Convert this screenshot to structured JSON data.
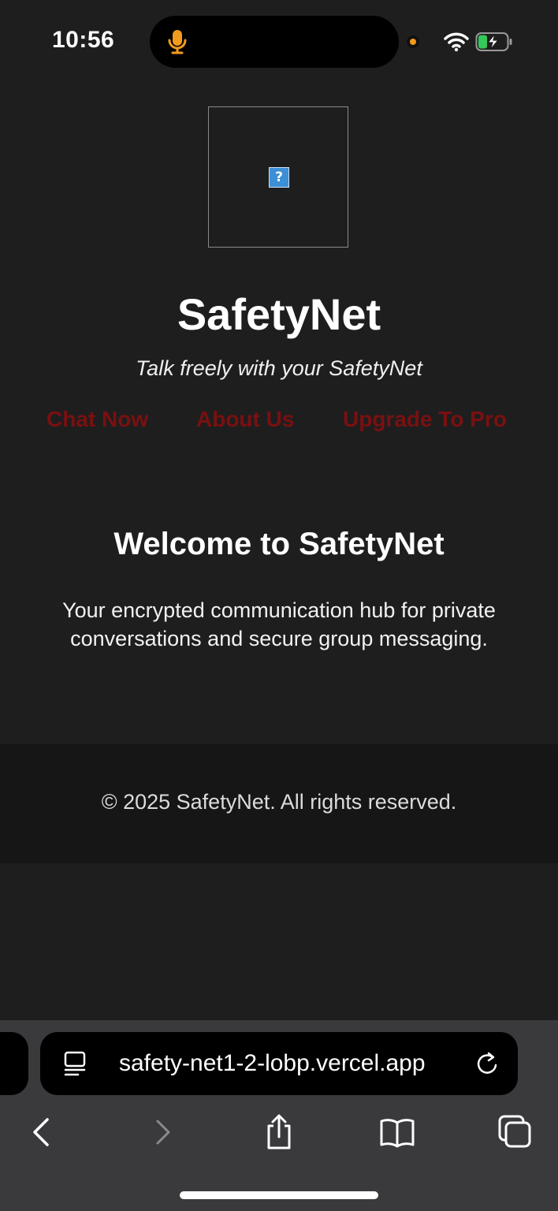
{
  "status_bar": {
    "time": "10:56",
    "icons": [
      "microphone-icon",
      "camera-indicator-dot",
      "wifi-icon",
      "battery-charging-icon"
    ],
    "indicator_color": "#f29b1d"
  },
  "page": {
    "logo_icon": "broken-image-icon",
    "logo_glyph": "?",
    "title": "SafetyNet",
    "tagline": "Talk freely with your SafetyNet",
    "nav": [
      {
        "label": "Chat Now"
      },
      {
        "label": "About Us"
      },
      {
        "label": "Upgrade To Pro"
      }
    ],
    "nav_color": "#7a1010",
    "welcome_title": "Welcome to SafetyNet",
    "welcome_text": "Your encrypted communication hub for private conversations and secure group messaging.",
    "footer": "© 2025 SafetyNet. All rights reserved."
  },
  "browser": {
    "url": "safety-net1-2-lobp.vercel.app",
    "toolbar": [
      "back-icon",
      "forward-icon",
      "share-icon",
      "bookmarks-icon",
      "tabs-icon"
    ]
  }
}
